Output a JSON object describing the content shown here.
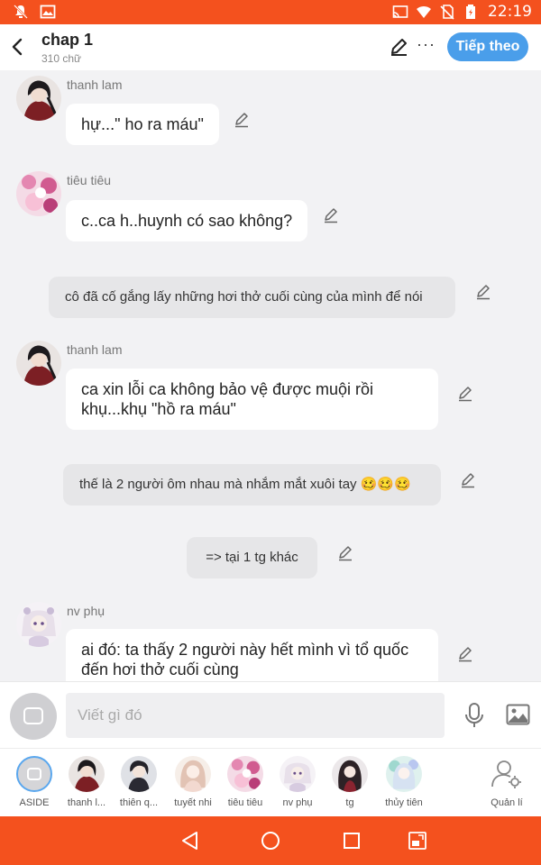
{
  "status_bar": {
    "time": "22:19",
    "left_icons": [
      "notifications-off-icon",
      "image-icon"
    ],
    "right_icons": [
      "cast-icon",
      "wifi-icon",
      "no-sim-icon",
      "battery-icon"
    ]
  },
  "header": {
    "title": "chap 1",
    "subtitle": "310 chữ",
    "next_label": "Tiếp theo",
    "more_label": "···"
  },
  "messages": [
    {
      "type": "character",
      "name": "thanh lam",
      "text": "hự...\" ho ra máu\""
    },
    {
      "type": "character",
      "name": "tiêu tiêu",
      "text": "c..ca h..huynh có sao không?"
    },
    {
      "type": "narration",
      "text": "cô đã cố gắng lấy những hơi thở cuối cùng của mình để nói"
    },
    {
      "type": "character",
      "name": "thanh lam",
      "text": "ca xin lỗi ca không bảo vệ được muội rồi khụ...khụ \"hồ ra máu\""
    },
    {
      "type": "narration",
      "text": "thế là 2 người ôm nhau mà nhắm mắt xuôi tay 🥴🥴🥴"
    },
    {
      "type": "narration",
      "text": "=> tại 1 tg khác"
    },
    {
      "type": "character",
      "name": "nv phụ",
      "text": "ai đó: ta thấy 2 người này hết mình vì tổ quốc đến hơi thở cuối cùng"
    }
  ],
  "input": {
    "placeholder": "Viết gì đó"
  },
  "characters": [
    {
      "label": "ASIDE"
    },
    {
      "label": "thanh l..."
    },
    {
      "label": "thiên q..."
    },
    {
      "label": "tuyết nhi"
    },
    {
      "label": "tiêu tiêu"
    },
    {
      "label": "nv phụ"
    },
    {
      "label": "tg"
    },
    {
      "label": "thủy tiên"
    }
  ],
  "manage_label": "Quản lí",
  "colors": {
    "accent": "#f4511e",
    "button_blue": "#4a9eea",
    "chat_background": "#f2f2f4",
    "narration_bubble": "#e6e6e8"
  }
}
